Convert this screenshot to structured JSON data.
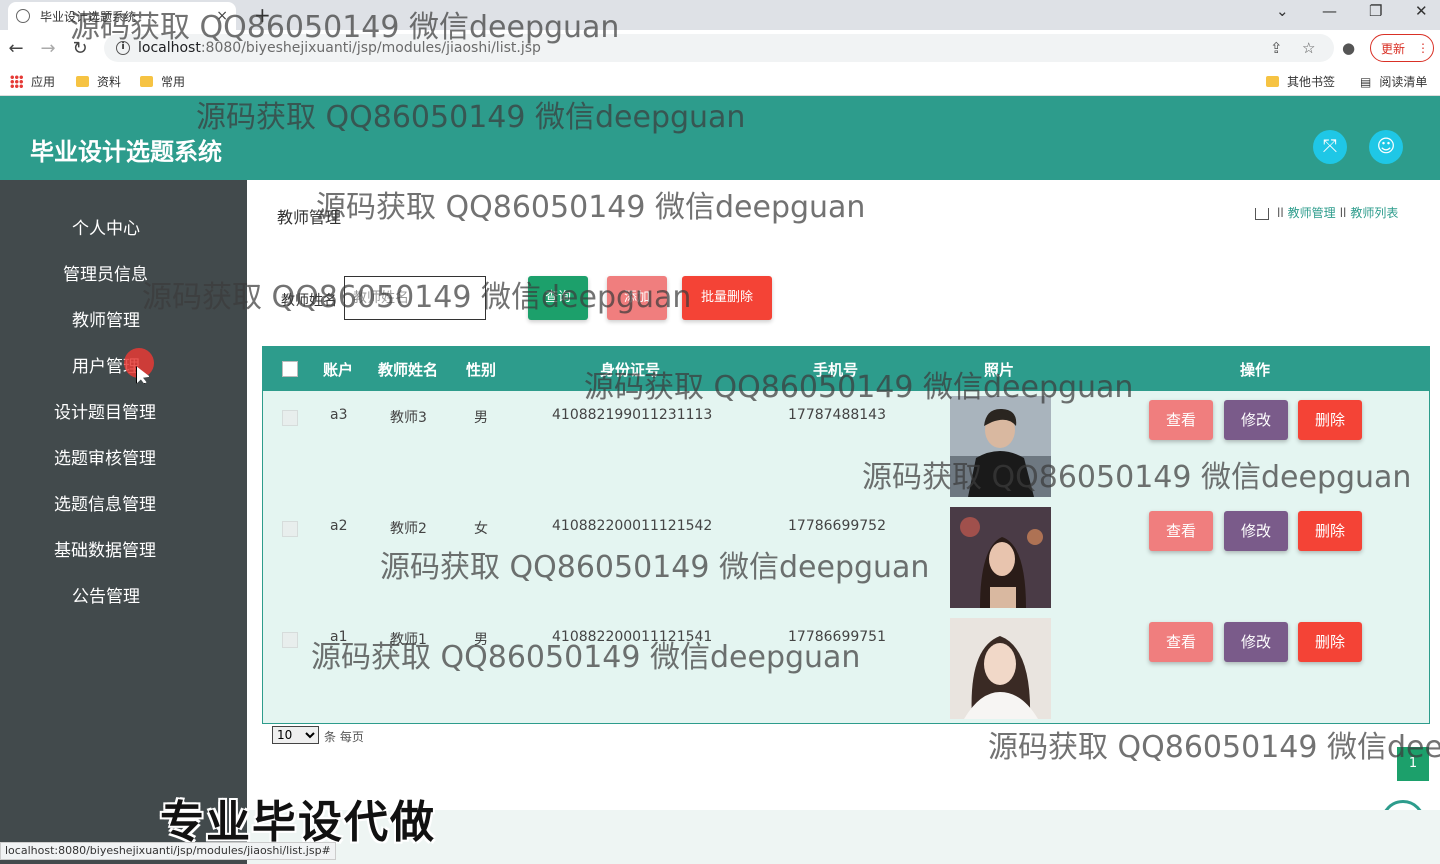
{
  "browser": {
    "tab_title": "毕业设计选题系统",
    "tab_close": "×",
    "new_tab": "+",
    "url_host": "localhost",
    "url_path": ":8080/biyeshejixuanti/jsp/modules/jiaoshi/list.jsp",
    "update_label": "更新",
    "bookmarks": [
      "应用",
      "资料",
      "常用"
    ],
    "other_bookmarks": "其他书签",
    "reading_list": "阅读清单",
    "status_url": "localhost:8080/biyeshejixuanti/jsp/modules/jiaoshi/list.jsp#"
  },
  "app": {
    "title": "毕业设计选题系统"
  },
  "sidebar": {
    "items": [
      {
        "label": "个人中心"
      },
      {
        "label": "管理员信息"
      },
      {
        "label": "教师管理"
      },
      {
        "label": "用户管理"
      },
      {
        "label": "设计题目管理"
      },
      {
        "label": "选题审核管理"
      },
      {
        "label": "选题信息管理"
      },
      {
        "label": "基础数据管理"
      },
      {
        "label": "公告管理"
      }
    ]
  },
  "page": {
    "title": "教师管理",
    "breadcrumb": [
      "教师管理",
      "教师列表"
    ],
    "breadcrumb_sep": "ll"
  },
  "search": {
    "label": "教师姓名",
    "placeholder": "教师姓名",
    "query_label": "查询",
    "add_label": "添加",
    "batch_delete_label": "批量删除"
  },
  "table": {
    "headers": [
      "账户",
      "教师姓名",
      "性别",
      "身份证号",
      "手机号",
      "照片",
      "操作"
    ],
    "rows": [
      {
        "account": "a3",
        "name": "教师3",
        "gender": "男",
        "id_number": "410882199011231113",
        "phone": "17787488143"
      },
      {
        "account": "a2",
        "name": "教师2",
        "gender": "女",
        "id_number": "410882200011121542",
        "phone": "17786699752"
      },
      {
        "account": "a1",
        "name": "教师1",
        "gender": "男",
        "id_number": "410882200011121541",
        "phone": "17786699751"
      }
    ],
    "actions": {
      "view": "查看",
      "edit": "修改",
      "delete": "删除"
    }
  },
  "pager": {
    "page_size": "10",
    "text": "条 每页",
    "current_page": "1"
  },
  "overlay": {
    "watermark": "源码获取 QQ86050149 微信deepguan",
    "promo": "专业毕设代做"
  },
  "colors": {
    "primary": "#2d9c8c",
    "sidebar": "#424a4c",
    "query": "#1ca06b",
    "add": "#f07e7e",
    "danger": "#f44336",
    "edit": "#7a5b8a"
  }
}
